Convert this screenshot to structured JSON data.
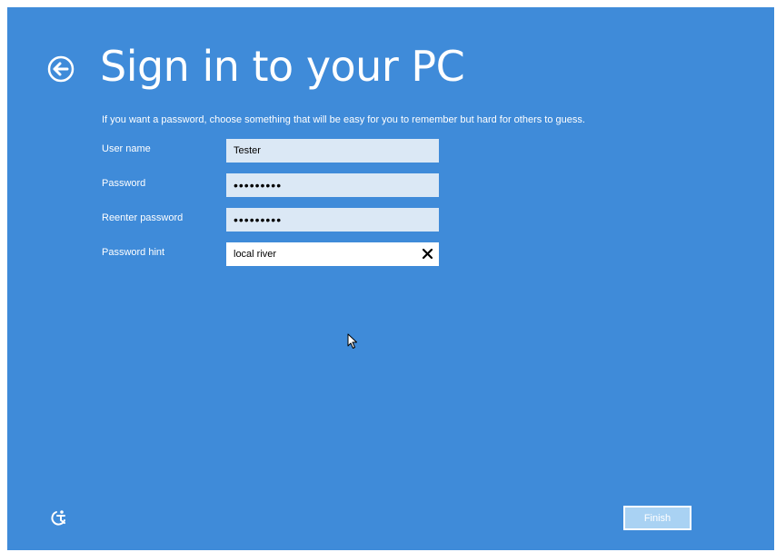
{
  "header": {
    "title": "Sign in to your PC"
  },
  "description": "If you want a password, choose something that will be easy for you to remember but hard for others to guess.",
  "form": {
    "username": {
      "label": "User name",
      "value": "Tester"
    },
    "password": {
      "label": "Password",
      "value": "•••••••••"
    },
    "reenter_password": {
      "label": "Reenter password",
      "value": "•••••••••"
    },
    "password_hint": {
      "label": "Password hint",
      "value": "local river"
    }
  },
  "footer": {
    "finish_label": "Finish"
  },
  "icons": {
    "back": "back-arrow-icon",
    "clear": "close-icon",
    "ease_of_access": "ease-of-access-icon",
    "pointer": "mouse-pointer-icon"
  },
  "colors": {
    "background": "#3f8bd9",
    "field_background": "#dbe8f5",
    "active_field_background": "#ffffff",
    "finish_button": "#a9d2f3",
    "text": "#ffffff"
  }
}
